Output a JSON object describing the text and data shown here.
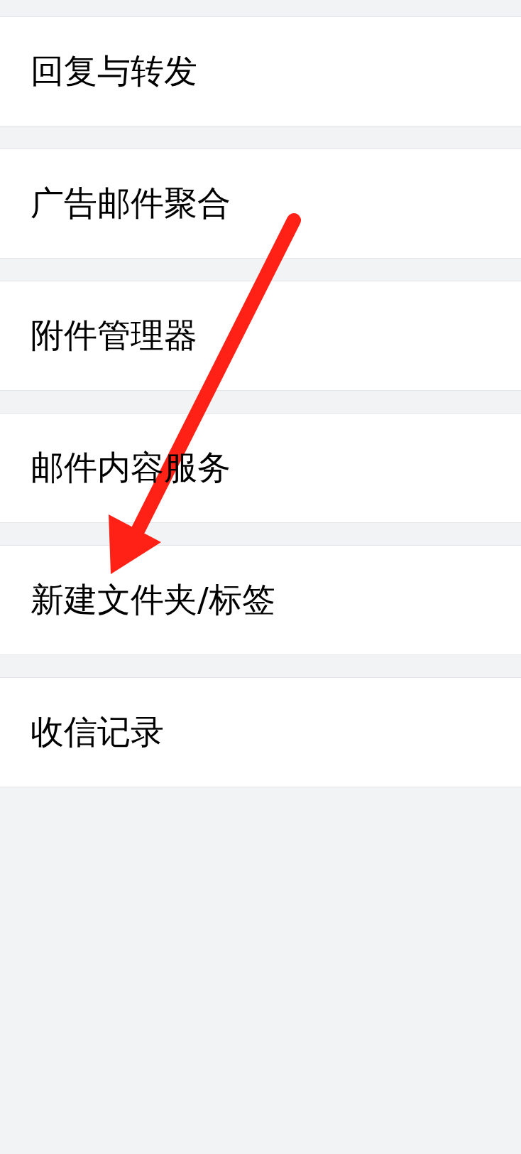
{
  "menu_items": [
    {
      "label": "回复与转发"
    },
    {
      "label": "广告邮件聚合"
    },
    {
      "label": "附件管理器"
    },
    {
      "label": "邮件内容服务"
    },
    {
      "label": "新建文件夹/标签"
    },
    {
      "label": "收信记录"
    }
  ]
}
